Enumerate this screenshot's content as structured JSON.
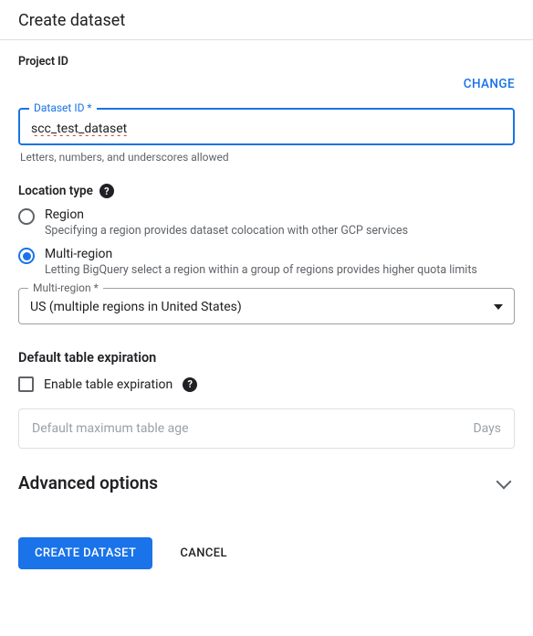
{
  "header": {
    "title": "Create dataset"
  },
  "project": {
    "label": "Project ID",
    "change": "CHANGE"
  },
  "dataset": {
    "label": "Dataset ID *",
    "value": "scc_test_dataset",
    "helper": "Letters, numbers, and underscores allowed"
  },
  "location": {
    "label": "Location type",
    "options": [
      {
        "label": "Region",
        "desc": "Specifying a region provides dataset colocation with other GCP services",
        "checked": false
      },
      {
        "label": "Multi-region",
        "desc": "Letting BigQuery select a region within a group of regions provides higher quota limits",
        "checked": true
      }
    ],
    "select": {
      "label": "Multi-region *",
      "value": "US (multiple regions in United States)"
    }
  },
  "expiration": {
    "heading": "Default table expiration",
    "checkbox_label": "Enable table expiration",
    "field_placeholder": "Default maximum table age",
    "unit": "Days"
  },
  "advanced": {
    "heading": "Advanced options"
  },
  "footer": {
    "primary": "CREATE DATASET",
    "cancel": "CANCEL"
  }
}
